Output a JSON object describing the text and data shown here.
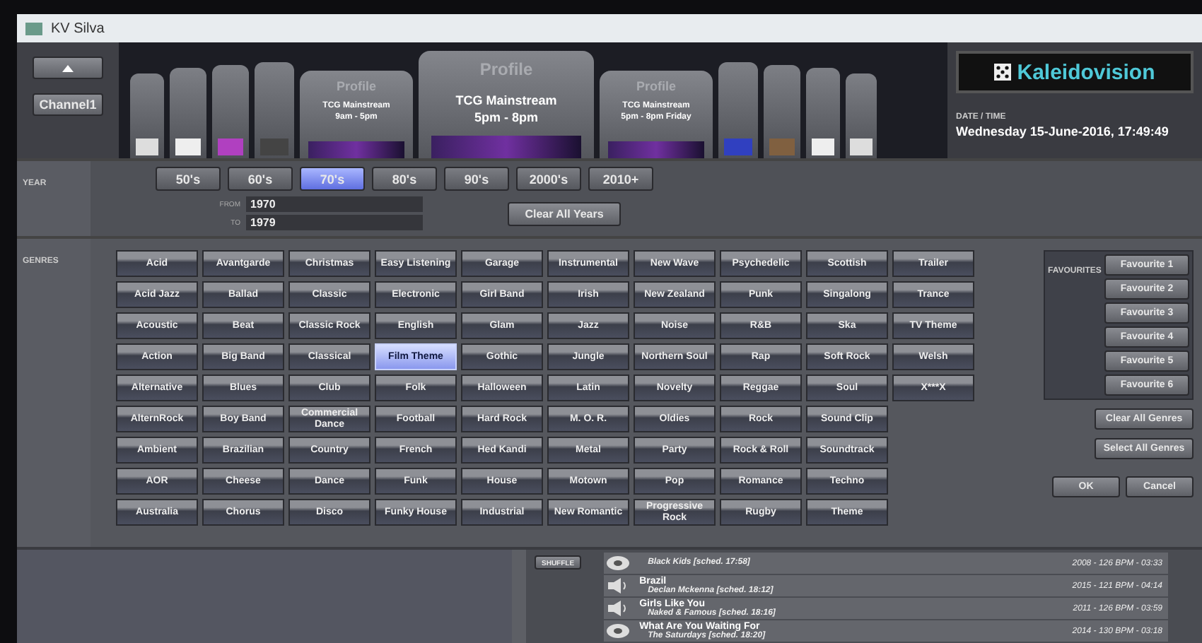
{
  "window": {
    "title": "KV Silva"
  },
  "channel": {
    "label": "Channel1"
  },
  "profiles": [
    {
      "heading": "Profile",
      "name": "TCG Mainstream",
      "time": "9am - 5pm",
      "selected": false
    },
    {
      "heading": "Profile",
      "name": "TCG Mainstream",
      "time": "5pm - 8pm",
      "selected": true
    },
    {
      "heading": "Profile",
      "name": "TCG Mainstream",
      "time": "5pm - 8pm Friday",
      "selected": false
    }
  ],
  "brand": {
    "logo": "Kaleidovision"
  },
  "datetime": {
    "label": "DATE / TIME",
    "value": "Wednesday 15-June-2016, 17:49:49"
  },
  "year": {
    "label": "YEAR",
    "decades": [
      {
        "label": "50's",
        "selected": false
      },
      {
        "label": "60's",
        "selected": false
      },
      {
        "label": "70's",
        "selected": true
      },
      {
        "label": "80's",
        "selected": false
      },
      {
        "label": "90's",
        "selected": false
      },
      {
        "label": "2000's",
        "selected": false
      },
      {
        "label": "2010+",
        "selected": false
      }
    ],
    "from_label": "FROM",
    "from": "1970",
    "to_label": "TO",
    "to": "1979",
    "clear": "Clear All Years"
  },
  "genres": {
    "label": "GENRES",
    "columns": [
      [
        {
          "label": "Acid",
          "selected": false
        },
        {
          "label": "Acid Jazz",
          "selected": false
        },
        {
          "label": "Acoustic",
          "selected": false
        },
        {
          "label": "Action",
          "selected": false
        },
        {
          "label": "Alternative",
          "selected": false
        },
        {
          "label": "AlternRock",
          "selected": false
        },
        {
          "label": "Ambient",
          "selected": false
        },
        {
          "label": "AOR",
          "selected": false
        },
        {
          "label": "Australia",
          "selected": false
        }
      ],
      [
        {
          "label": "Avantgarde",
          "selected": false
        },
        {
          "label": "Ballad",
          "selected": false
        },
        {
          "label": "Beat",
          "selected": false
        },
        {
          "label": "Big Band",
          "selected": false
        },
        {
          "label": "Blues",
          "selected": false
        },
        {
          "label": "Boy Band",
          "selected": false
        },
        {
          "label": "Brazilian",
          "selected": false
        },
        {
          "label": "Cheese",
          "selected": false
        },
        {
          "label": "Chorus",
          "selected": false
        }
      ],
      [
        {
          "label": "Christmas",
          "selected": false
        },
        {
          "label": "Classic",
          "selected": false
        },
        {
          "label": "Classic Rock",
          "selected": false
        },
        {
          "label": "Classical",
          "selected": false
        },
        {
          "label": "Club",
          "selected": false
        },
        {
          "label": "Commercial Dance",
          "selected": false
        },
        {
          "label": "Country",
          "selected": false
        },
        {
          "label": "Dance",
          "selected": false
        },
        {
          "label": "Disco",
          "selected": false
        }
      ],
      [
        {
          "label": "Easy Listening",
          "selected": false
        },
        {
          "label": "Electronic",
          "selected": false
        },
        {
          "label": "English",
          "selected": false
        },
        {
          "label": "Film Theme",
          "selected": true
        },
        {
          "label": "Folk",
          "selected": false
        },
        {
          "label": "Football",
          "selected": false
        },
        {
          "label": "French",
          "selected": false
        },
        {
          "label": "Funk",
          "selected": false
        },
        {
          "label": "Funky House",
          "selected": false
        }
      ],
      [
        {
          "label": "Garage",
          "selected": false
        },
        {
          "label": "Girl Band",
          "selected": false
        },
        {
          "label": "Glam",
          "selected": false
        },
        {
          "label": "Gothic",
          "selected": false
        },
        {
          "label": "Halloween",
          "selected": false
        },
        {
          "label": "Hard Rock",
          "selected": false
        },
        {
          "label": "Hed Kandi",
          "selected": false
        },
        {
          "label": "House",
          "selected": false
        },
        {
          "label": "Industrial",
          "selected": false
        }
      ],
      [
        {
          "label": "Instrumental",
          "selected": false
        },
        {
          "label": "Irish",
          "selected": false
        },
        {
          "label": "Jazz",
          "selected": false
        },
        {
          "label": "Jungle",
          "selected": false
        },
        {
          "label": "Latin",
          "selected": false
        },
        {
          "label": "M. O. R.",
          "selected": false
        },
        {
          "label": "Metal",
          "selected": false
        },
        {
          "label": "Motown",
          "selected": false
        },
        {
          "label": "New Romantic",
          "selected": false
        }
      ],
      [
        {
          "label": "New Wave",
          "selected": false
        },
        {
          "label": "New Zealand",
          "selected": false
        },
        {
          "label": "Noise",
          "selected": false
        },
        {
          "label": "Northern Soul",
          "selected": false
        },
        {
          "label": "Novelty",
          "selected": false
        },
        {
          "label": "Oldies",
          "selected": false
        },
        {
          "label": "Party",
          "selected": false
        },
        {
          "label": "Pop",
          "selected": false
        },
        {
          "label": "Progressive Rock",
          "selected": false
        }
      ],
      [
        {
          "label": "Psychedelic",
          "selected": false
        },
        {
          "label": "Punk",
          "selected": false
        },
        {
          "label": "R&B",
          "selected": false
        },
        {
          "label": "Rap",
          "selected": false
        },
        {
          "label": "Reggae",
          "selected": false
        },
        {
          "label": "Rock",
          "selected": false
        },
        {
          "label": "Rock & Roll",
          "selected": false
        },
        {
          "label": "Romance",
          "selected": false
        },
        {
          "label": "Rugby",
          "selected": false
        }
      ],
      [
        {
          "label": "Scottish",
          "selected": false
        },
        {
          "label": "Singalong",
          "selected": false
        },
        {
          "label": "Ska",
          "selected": false
        },
        {
          "label": "Soft Rock",
          "selected": false
        },
        {
          "label": "Soul",
          "selected": false
        },
        {
          "label": "Sound Clip",
          "selected": false
        },
        {
          "label": "Soundtrack",
          "selected": false
        },
        {
          "label": "Techno",
          "selected": false
        },
        {
          "label": "Theme",
          "selected": false
        }
      ],
      [
        {
          "label": "Trailer",
          "selected": false
        },
        {
          "label": "Trance",
          "selected": false
        },
        {
          "label": "TV Theme",
          "selected": false
        },
        {
          "label": "Welsh",
          "selected": false
        },
        {
          "label": "X***X",
          "selected": false
        }
      ]
    ]
  },
  "favourites": {
    "label": "FAVOURITES",
    "items": [
      "Favourite 1",
      "Favourite 2",
      "Favourite 3",
      "Favourite 4",
      "Favourite 5",
      "Favourite 6"
    ]
  },
  "actions": {
    "clear_genres": "Clear All Genres",
    "select_genres": "Select All Genres",
    "ok": "OK",
    "cancel": "Cancel"
  },
  "shuffle": "SHUFFLE",
  "playlist": [
    {
      "kind": "disc",
      "artist": "Black Kids  [sched. 17:58]",
      "info": "2008 - 126 BPM - 03:33"
    },
    {
      "kind": "speaker",
      "title": "Brazil",
      "artist": "Declan Mckenna  [sched. 18:12]",
      "info": "2015 - 121 BPM - 04:14"
    },
    {
      "kind": "speaker",
      "title": "Girls Like You",
      "artist": "Naked & Famous  [sched. 18:16]",
      "info": "2011 - 126 BPM - 03:59"
    },
    {
      "kind": "disc",
      "title": "What Are You Waiting For",
      "artist": "The Saturdays  [sched. 18:20]",
      "info": "2014 - 130 BPM - 03:18"
    }
  ]
}
